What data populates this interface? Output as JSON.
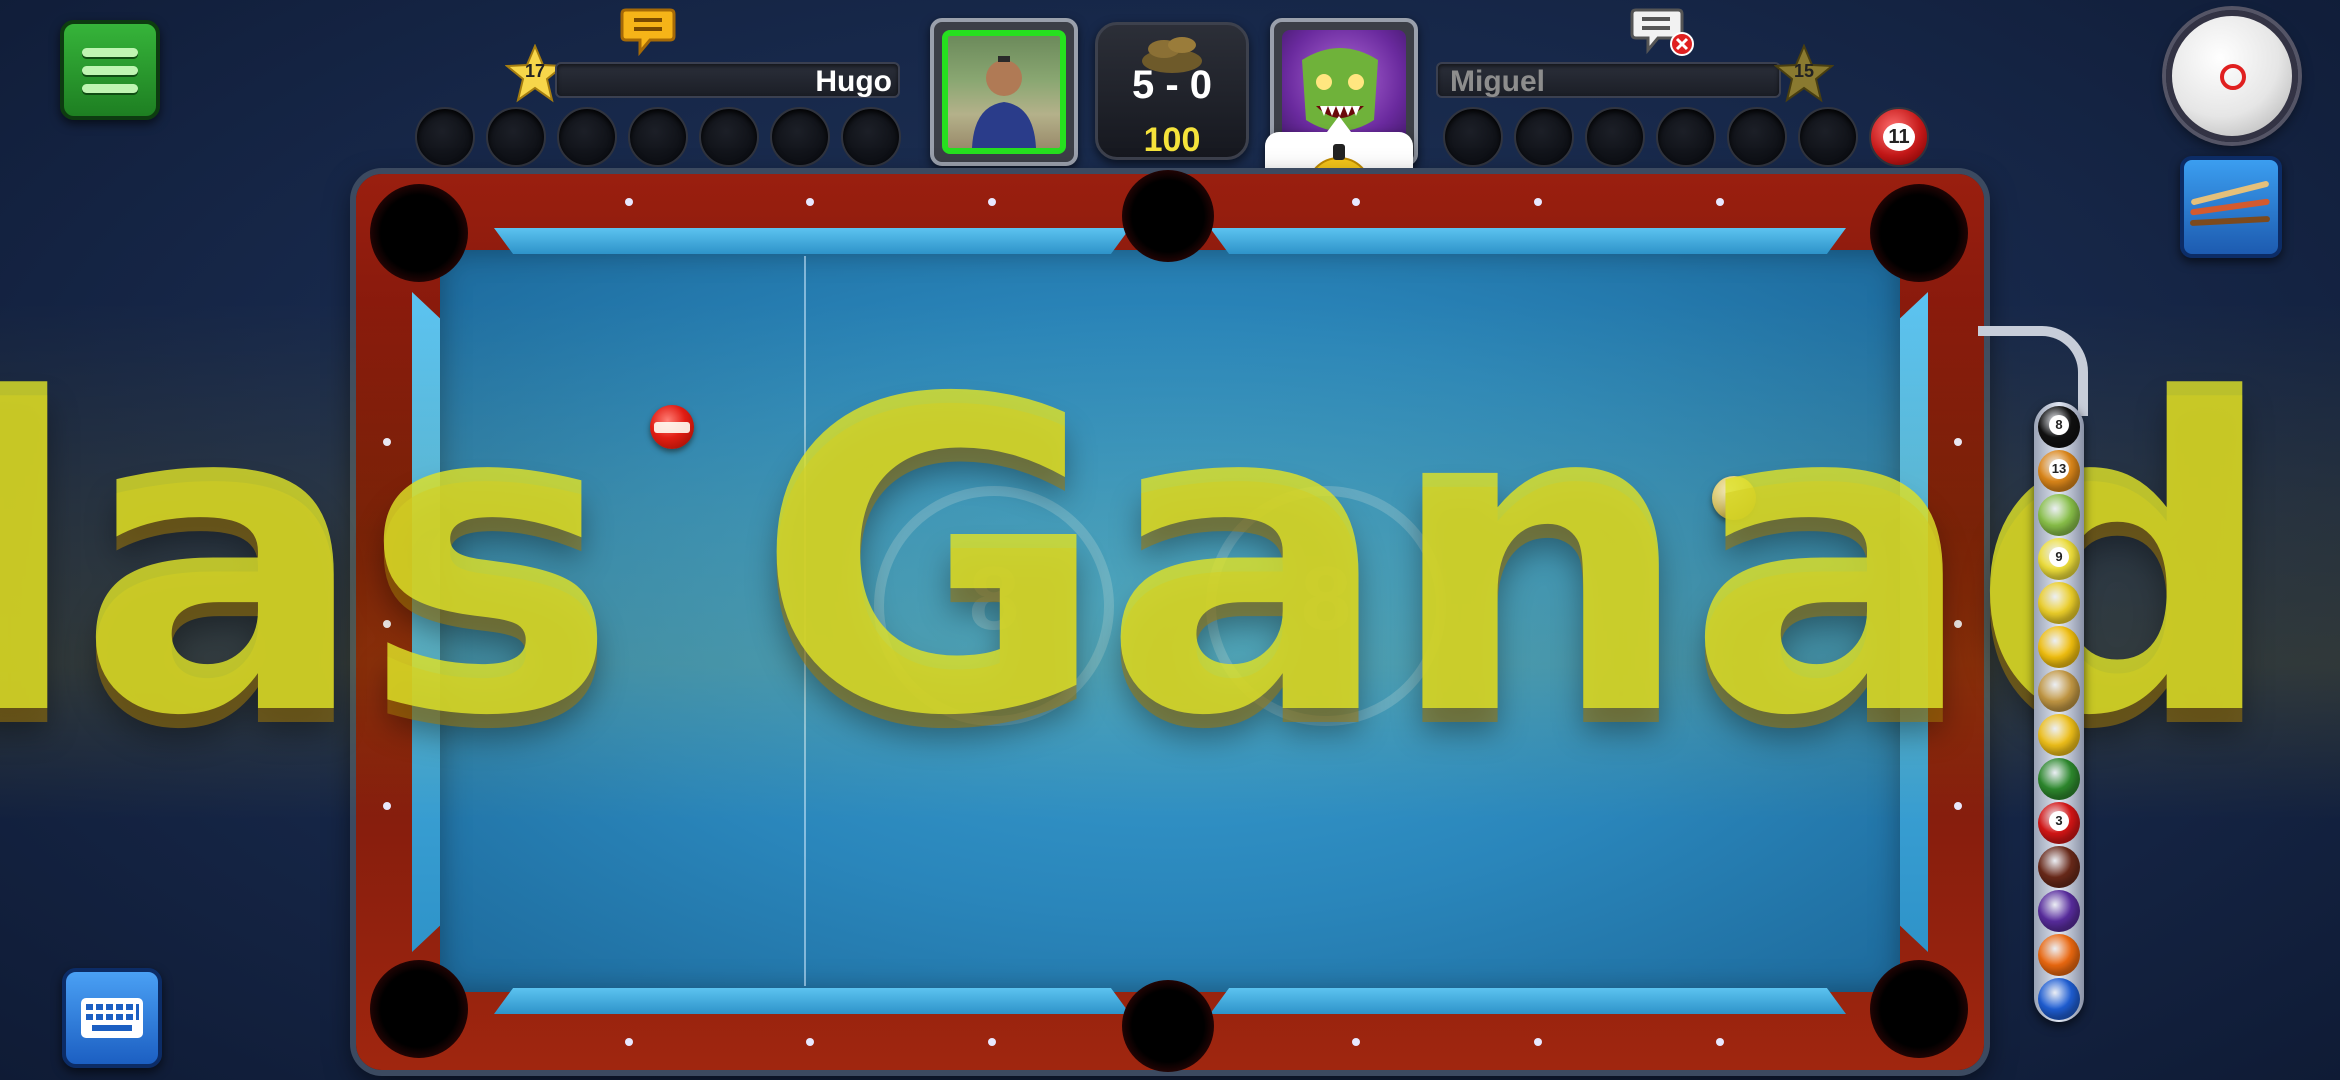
{
  "player1": {
    "name": "Hugo",
    "level": "17",
    "slots": 7
  },
  "player2": {
    "name": "Miguel",
    "level": "15",
    "slots": 6,
    "last_ball": "11"
  },
  "match": {
    "score": "5 - 0",
    "bet": "100"
  },
  "overlay": {
    "text": "las Ganad"
  },
  "icons": {
    "menu": "menu-icon",
    "keyboard": "keyboard-icon",
    "cue": "cue-icon",
    "chat_p1": "chat-bubble-icon",
    "chat_p2": "chat-muted-icon",
    "emoji": "sleeping-emoji-icon"
  },
  "emoji_timer_fraction": 0.2,
  "rack_balls": [
    {
      "num": "8",
      "color": "#111111"
    },
    {
      "num": "13",
      "color": "#e0891a"
    },
    {
      "num": "",
      "color": "#8bc34a"
    },
    {
      "num": "9",
      "color": "#f2e23b"
    },
    {
      "num": "",
      "color": "#f0d22a"
    },
    {
      "num": "",
      "color": "#f5c20f"
    },
    {
      "num": "",
      "color": "#c59a45"
    },
    {
      "num": "",
      "color": "#f2c21a"
    },
    {
      "num": "",
      "color": "#2e8b2e"
    },
    {
      "num": "3",
      "color": "#d81616"
    },
    {
      "num": "",
      "color": "#6b2a1a"
    },
    {
      "num": "",
      "color": "#5a2da0"
    },
    {
      "num": "",
      "color": "#ef6a10"
    },
    {
      "num": "",
      "color": "#1f5fd6"
    }
  ],
  "colors": {
    "felt": "#2a86bb",
    "rail": "#8a1a0c",
    "accent_green": "#26e01f",
    "bet_yellow": "#f5e33b"
  }
}
